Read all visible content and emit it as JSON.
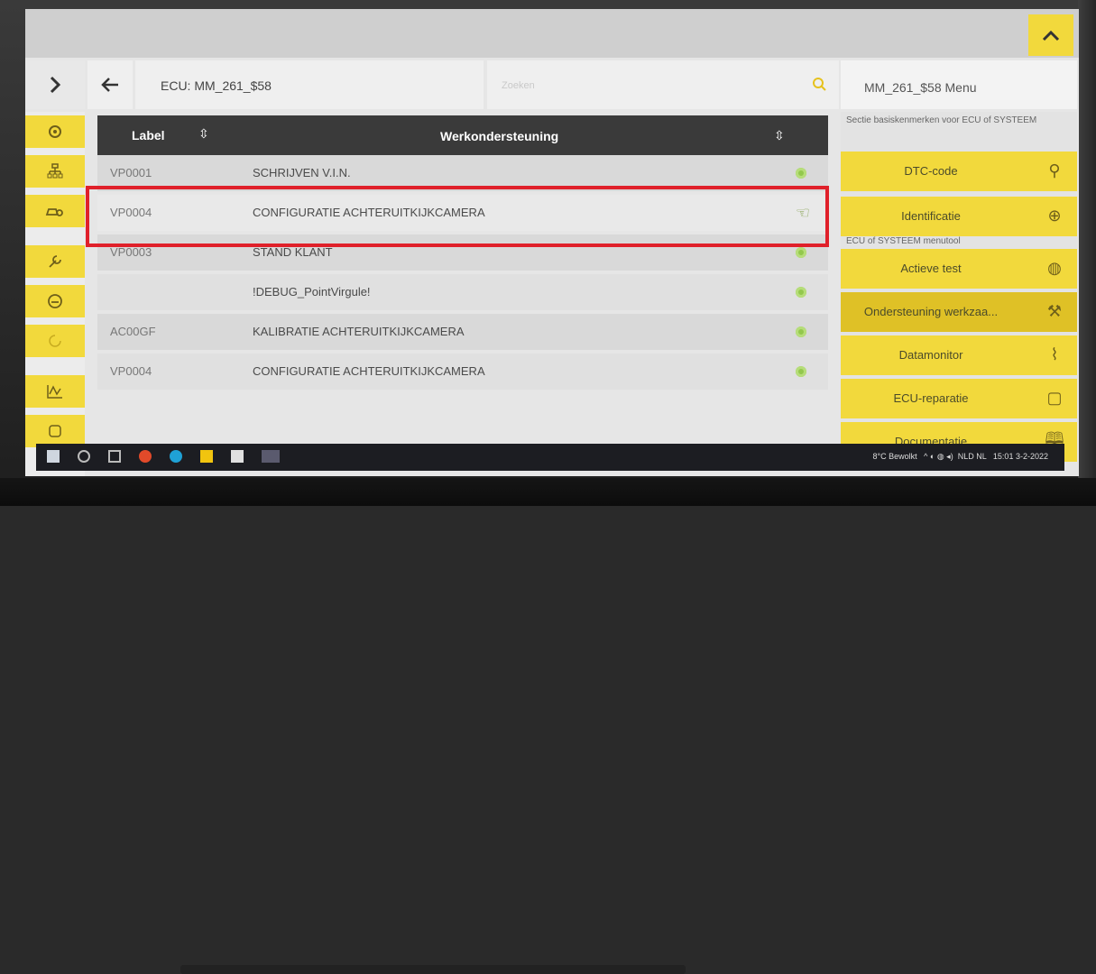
{
  "header": {
    "ecu_title": "ECU: MM_261_$58",
    "search_placeholder": "Zoeken",
    "menu_title": "MM_261_$58 Menu"
  },
  "table": {
    "columns": [
      "Label",
      "Werkondersteuning"
    ],
    "rows": [
      {
        "label": "VP0001",
        "task": "SCHRIJVEN V.I.N."
      },
      {
        "label": "VP0004",
        "task": "CONFIGURATIE ACHTERUITKIJKCAMERA"
      },
      {
        "label": "VP0003",
        "task": "STAND KLANT"
      },
      {
        "label": "",
        "task": "!DEBUG_PointVirgule!"
      },
      {
        "label": "AC00GF",
        "task": "KALIBRATIE ACHTERUITKIJKCAMERA"
      },
      {
        "label": "VP0004",
        "task": "CONFIGURATIE ACHTERUITKIJKCAMERA"
      }
    ],
    "selected_index": 1
  },
  "right_menu": {
    "section1": "Sectie basiskenmerken voor ECU of SYSTEEM",
    "section2": "ECU of SYSTEEM menutool",
    "items": [
      {
        "label": "DTC-code",
        "icon": "car-search-icon"
      },
      {
        "label": "Identificatie",
        "icon": "zoom-in-icon"
      },
      {
        "label": "Actieve test",
        "icon": "gamepad-icon"
      },
      {
        "label": "Ondersteuning werkzaa...",
        "icon": "wrench-icon"
      },
      {
        "label": "Datamonitor",
        "icon": "graph-icon"
      },
      {
        "label": "ECU-reparatie",
        "icon": "square-icon"
      },
      {
        "label": "Documentatie",
        "icon": "book-icon"
      }
    ]
  },
  "taskbar": {
    "weather": "8°C Bewolkt",
    "lang1": "NLD",
    "lang2": "NL",
    "time": "15:01",
    "date": "3-2-2022"
  },
  "colors": {
    "accent": "#f2d93c",
    "header_dark": "#3a3a3a",
    "highlight": "#e0202a",
    "status_dot": "#93c84d"
  }
}
